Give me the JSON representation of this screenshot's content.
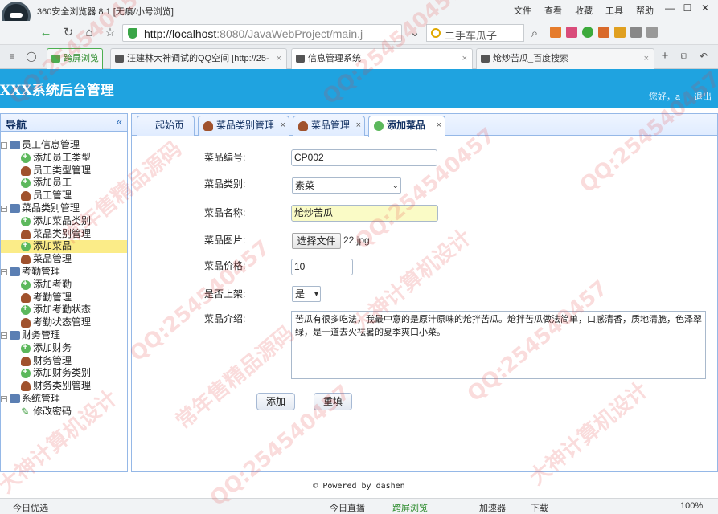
{
  "browser": {
    "title": "360安全浏览器 8.1 [无痕/小号浏览]",
    "menu": [
      "文件",
      "查看",
      "收藏",
      "工具",
      "帮助"
    ],
    "url_host": "http://localhost",
    "url_rest": ":8080/JavaWebProject/main.j",
    "search_text": "二手车瓜子",
    "tabs": [
      {
        "label": "跨屏浏览"
      },
      {
        "label": "汪建林大神调试的QQ空间 [http://25-"
      },
      {
        "label": "信息管理系统"
      },
      {
        "label": "炝炒苦瓜_百度搜索"
      }
    ]
  },
  "app": {
    "title": "XXX系统后台管理",
    "user_greeting": "您好，a",
    "logout": "退出"
  },
  "sidebar": {
    "title": "导航",
    "collapse": "«",
    "tree": [
      {
        "label": "员工信息管理",
        "level": 0
      },
      {
        "label": "添加员工类型",
        "level": 1,
        "icon": "add"
      },
      {
        "label": "员工类型管理",
        "level": 1,
        "icon": "user"
      },
      {
        "label": "添加员工",
        "level": 1,
        "icon": "add"
      },
      {
        "label": "员工管理",
        "level": 1,
        "icon": "user"
      },
      {
        "label": "菜品类别管理",
        "level": 0
      },
      {
        "label": "添加菜品类别",
        "level": 1,
        "icon": "add"
      },
      {
        "label": "菜品类别管理",
        "level": 1,
        "icon": "user"
      },
      {
        "label": "添加菜品",
        "level": 1,
        "icon": "add",
        "selected": true
      },
      {
        "label": "菜品管理",
        "level": 1,
        "icon": "user"
      },
      {
        "label": "考勤管理",
        "level": 0
      },
      {
        "label": "添加考勤",
        "level": 1,
        "icon": "add"
      },
      {
        "label": "考勤管理",
        "level": 1,
        "icon": "user"
      },
      {
        "label": "添加考勤状态",
        "level": 1,
        "icon": "add"
      },
      {
        "label": "考勤状态管理",
        "level": 1,
        "icon": "user"
      },
      {
        "label": "财务管理",
        "level": 0
      },
      {
        "label": "添加财务",
        "level": 1,
        "icon": "add"
      },
      {
        "label": "财务管理",
        "level": 1,
        "icon": "user"
      },
      {
        "label": "添加财务类别",
        "level": 1,
        "icon": "add"
      },
      {
        "label": "财务类别管理",
        "level": 1,
        "icon": "user"
      },
      {
        "label": "系统管理",
        "level": 0
      },
      {
        "label": "修改密码",
        "level": 1,
        "icon": "pen"
      }
    ]
  },
  "content_tabs": [
    {
      "label": "起始页"
    },
    {
      "label": "菜品类别管理"
    },
    {
      "label": "菜品管理"
    },
    {
      "label": "添加菜品"
    }
  ],
  "form": {
    "code_label": "菜品编号:",
    "code_value": "CP002",
    "type_label": "菜品类别:",
    "type_value": "素菜",
    "name_label": "菜品名称:",
    "name_value": "炝炒苦瓜",
    "image_label": "菜品图片:",
    "image_button": "选择文件",
    "image_file": "22.jpg",
    "price_label": "菜品价格:",
    "price_value": "10",
    "onsale_label": "是否上架:",
    "onsale_value": "是",
    "desc_label": "菜品介绍:",
    "desc_value": "苦瓜有很多吃法，我最中意的是原汁原味的炝拌苦瓜。炝拌苦瓜做法简单，口感清香，质地清脆，色泽翠绿，是一道去火祛暑的夏季爽口小菜。",
    "submit": "添加",
    "reset": "重填"
  },
  "footer": "© Powered by dashen",
  "statusbar": {
    "left": "今日优选",
    "live": "今日直播",
    "cross": "跨屏浏览",
    "speed": "加速器",
    "download": "下载",
    "zoom": "100%"
  },
  "watermarks": [
    "QQ:254540457",
    "大神计算机设计",
    "常年售精品源码",
    "QQ:254540457",
    "大神计算机设计",
    "常年售精品源码",
    "QQ:254540457",
    "QQ:254540457"
  ]
}
